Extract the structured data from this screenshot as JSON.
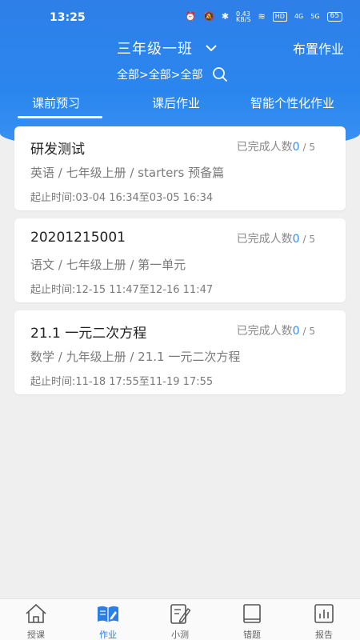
{
  "status": {
    "time": "13:25",
    "speed": "0.43\nKB/S",
    "hd": "HD",
    "net1": "4G",
    "net2": "5G",
    "battery": "65"
  },
  "header": {
    "class_name": "三年级一班",
    "assign_label": "布置作业",
    "filter": "全部>全部>全部"
  },
  "tabs": [
    {
      "label": "课前预习",
      "active": true
    },
    {
      "label": "课后作业",
      "active": false
    },
    {
      "label": "智能个性化作业",
      "active": false
    }
  ],
  "done_label": "已完成人数",
  "cards": [
    {
      "title": "研发测试",
      "done": "0",
      "total": "/ 5",
      "subject": "英语 / 七年级上册 / starters 预备篇",
      "period": "起止时间:03-04 16:34至03-05 16:34"
    },
    {
      "title": "20201215001",
      "done": "0",
      "total": "/ 5",
      "subject": "语文 / 七年级上册 / 第一单元",
      "period": "起止时间:12-15 11:47至12-16 11:47"
    },
    {
      "title": "21.1 一元二次方程",
      "done": "0",
      "total": "/ 5",
      "subject": "数学 / 九年级上册 / 21.1 一元二次方程",
      "period": "起止时间:11-18 17:55至11-19 17:55"
    }
  ],
  "nav": [
    {
      "label": "授课",
      "icon": "home-icon"
    },
    {
      "label": "作业",
      "icon": "book-edit-icon",
      "active": true
    },
    {
      "label": "小测",
      "icon": "note-edit-icon"
    },
    {
      "label": "错题",
      "icon": "book-icon"
    },
    {
      "label": "报告",
      "icon": "chart-icon"
    }
  ],
  "colors": {
    "primary": "#2f7fe8",
    "accent_number": "#2f8df0",
    "background": "#efefef"
  }
}
